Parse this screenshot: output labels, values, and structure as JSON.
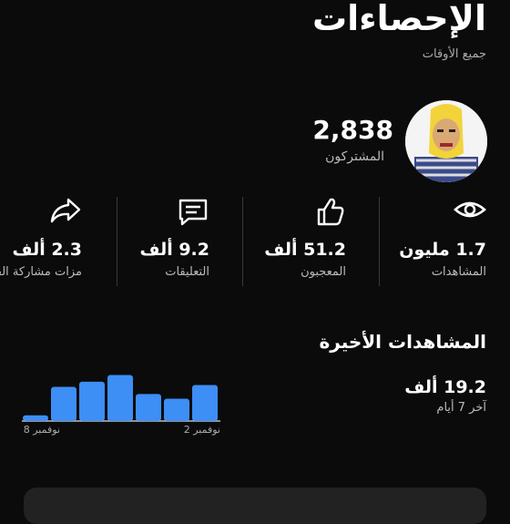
{
  "header": {
    "title": "الإحصاءات",
    "subtitle": "جميع الأوقات"
  },
  "profile": {
    "subscriber_count": "2,838",
    "subscriber_label": "المشتركون",
    "avatar_icon": "avatar-figure-icon"
  },
  "stats": [
    {
      "value": "1.7 مليون",
      "label": "المشاهدات",
      "icon": "eye-icon"
    },
    {
      "value": "51.2 ألف",
      "label": "المعجبون",
      "icon": "thumbs-up-icon"
    },
    {
      "value": "9.2 ألف",
      "label": "التعليقات",
      "icon": "comment-icon"
    },
    {
      "value": "2.3 ألف",
      "label": "مزات مشاركة الفي",
      "icon": "share-icon"
    }
  ],
  "recent": {
    "title": "المشاهدات الأخيرة",
    "value": "19.2 ألف",
    "period": "آخر 7 أيام"
  },
  "chart_data": {
    "type": "bar",
    "categories": [
      "8 نوفمبر",
      "",
      "",
      "",
      "",
      "",
      "2 نوفمبر"
    ],
    "values": [
      0.12,
      0.72,
      0.83,
      0.97,
      0.57,
      0.47,
      0.76
    ],
    "tick_labels": [
      "8 نوفمبر",
      "2 نوفمبر"
    ],
    "color": "#3d8ef5",
    "grid": false
  }
}
